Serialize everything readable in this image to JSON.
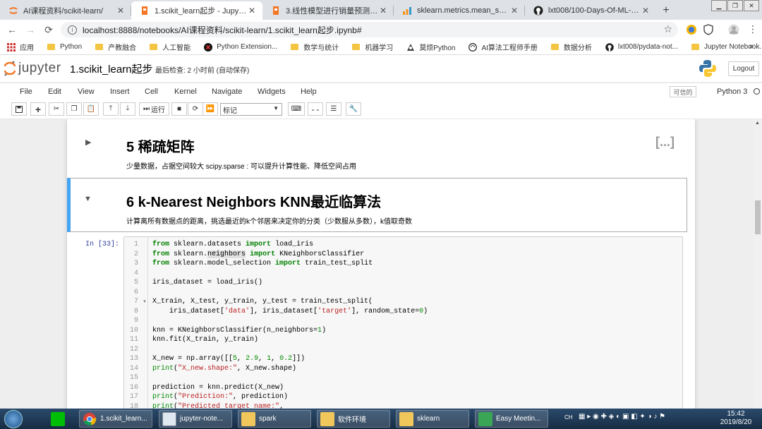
{
  "browser": {
    "tabs": [
      {
        "title": "AI课程资料/scikit-learn/",
        "active": false
      },
      {
        "title": "1.scikit_learn起步 - Jupyter No",
        "active": true
      },
      {
        "title": "3.线性模型进行销量预测 - Jupy",
        "active": false
      },
      {
        "title": "sklearn.metrics.mean_squared",
        "active": false
      },
      {
        "title": "lxt008/100-Days-Of-ML-Code",
        "active": false
      }
    ],
    "url": "localhost:8888/notebooks/AI课程资料/scikit-learn/1.scikit_learn起步.ipynb#",
    "bookmarks": [
      "应用",
      "Python",
      "产教融合",
      "人工智能",
      "Python Extension...",
      "数学与统计",
      "机器学习",
      "莫烦Python",
      "AI算法工程师手册",
      "数据分析",
      "lxt008/pydata-not...",
      "Jupyter Notebook..."
    ]
  },
  "jupyter": {
    "logo_text": "jupyter",
    "notebook_name": "1.scikit_learn起步",
    "checkpoint": "最后检查: 2 小时前  (自动保存)",
    "logout": "Logout",
    "menus": [
      "File",
      "Edit",
      "View",
      "Insert",
      "Cell",
      "Kernel",
      "Navigate",
      "Widgets",
      "Help"
    ],
    "trusted": "可信的",
    "kernel": "Python 3",
    "toolbar": {
      "run_label": "运行",
      "cell_type": "标记"
    }
  },
  "cells": {
    "sec5": {
      "heading": "5  稀疏矩阵",
      "text": "少量数据，占据空间较大 scipy.sparse : 可以提升计算性能、降低空间占用",
      "ellipsis": "[...]"
    },
    "sec6": {
      "heading": "6  k-Nearest Neighbors KNN最近临算法",
      "text": "计算离所有数据点的距离，挑选最近的k个邻居来决定你的分类（少数服从多数），k值取奇数"
    },
    "code": {
      "prompt": "In  [33]:",
      "line_numbers": [
        "1",
        "2",
        "3",
        "4",
        "5",
        "6",
        "7",
        "8",
        "9",
        "10",
        "11",
        "12",
        "13",
        "14",
        "15",
        "16",
        "17",
        "18"
      ]
    }
  },
  "taskbar": {
    "items": [
      "1.scikit_learn...",
      "jupyter-note...",
      "spark",
      "软件环境",
      "sklearn",
      "Easy Meetin..."
    ],
    "tray_lang": "CH",
    "time": "15:42",
    "date": "2019/8/20"
  }
}
